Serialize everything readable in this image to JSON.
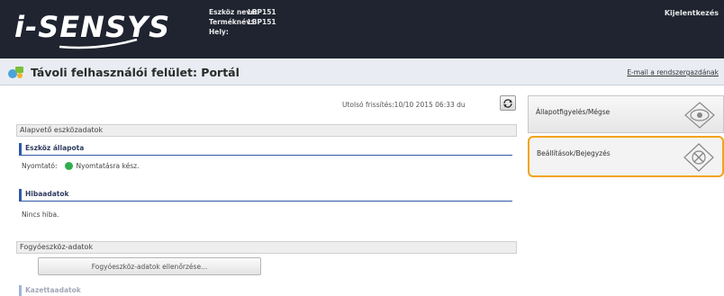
{
  "header": {
    "logo": "i-SENSYS",
    "device_name_label": "Eszköz neve:",
    "device_name": "LBP151",
    "product_name_label": "Terméknév:",
    "product_name": "LBP151",
    "location_label": "Hely:",
    "location": "",
    "logout": "Kijelentkezés"
  },
  "titlebar": {
    "title": "Távoli felhasználói felület: Portál",
    "mail_link": "E-mail a rendszergazdának"
  },
  "main": {
    "last_refresh": "Utolsó frissítés:10/10 2015 06:33 du",
    "basic_section": "Alapvető eszközadatok",
    "device_status": {
      "heading": "Eszköz állapota",
      "printer_label": "Nyomtató:",
      "printer_status": "Nyomtatásra kész.",
      "status_color": "#2fae4e"
    },
    "error_info": {
      "heading": "Hibaadatok",
      "text": "Nincs hiba."
    },
    "consumables_section": "Fogyóeszköz-adatok",
    "consumables_button": "Fogyóeszköz-adatok ellenőrzése...",
    "cartridge_heading": "Kazettaadatok"
  },
  "side": {
    "items": [
      {
        "label": "Állapotfigyelés/Mégse",
        "icon": "eye-icon"
      },
      {
        "label": "Beállítások/Bejegyzés",
        "icon": "settings-icon"
      }
    ],
    "highlight_color": "#f2a317"
  }
}
